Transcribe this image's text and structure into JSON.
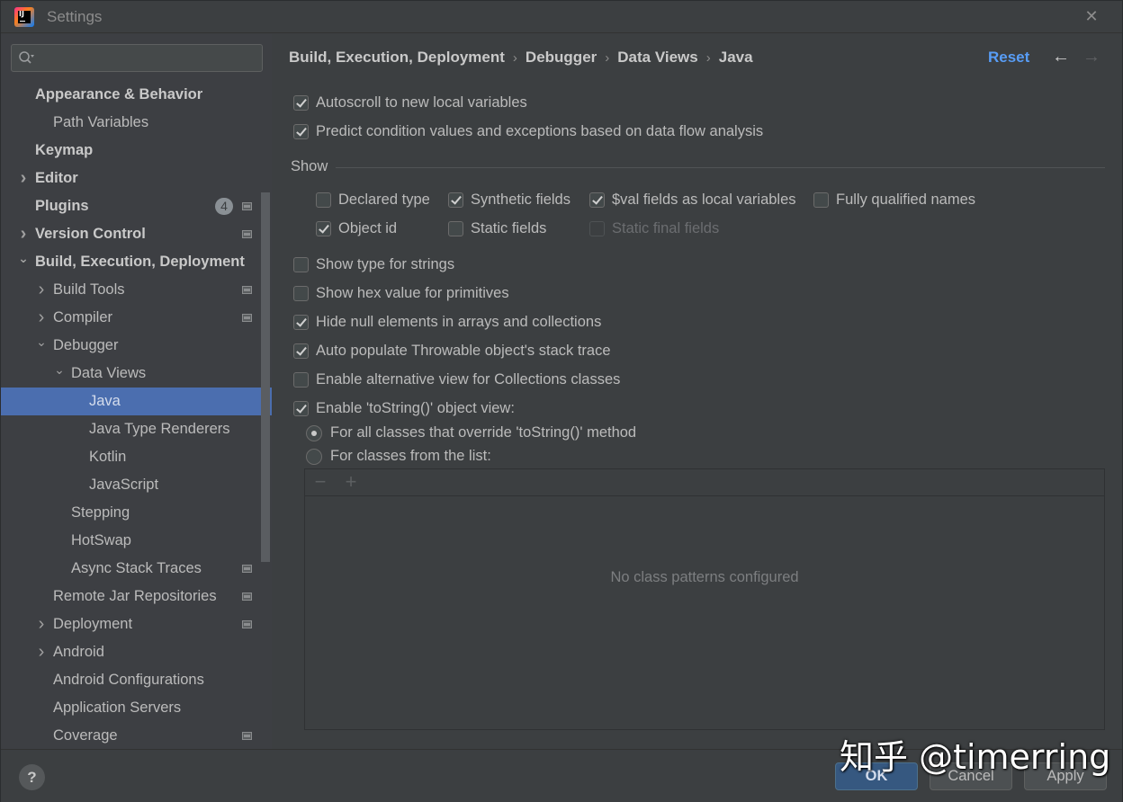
{
  "window": {
    "title": "Settings",
    "app_icon": "intellij-idea-icon",
    "close_icon": "close-icon",
    "close_glyph": "✕"
  },
  "sidebar": {
    "search": {
      "placeholder": "",
      "value": "",
      "icon": "search-icon"
    },
    "items": [
      {
        "label": "Appearance & Behavior",
        "level": 0,
        "bold": true,
        "chevron": "none"
      },
      {
        "label": "Path Variables",
        "level": 1,
        "bold": false,
        "chevron": "none"
      },
      {
        "label": "Keymap",
        "level": 0,
        "bold": true,
        "chevron": "none"
      },
      {
        "label": "Editor",
        "level": 0,
        "bold": true,
        "chevron": "collapsed"
      },
      {
        "label": "Plugins",
        "level": 0,
        "bold": true,
        "chevron": "none",
        "badge": "4",
        "project_icon": true
      },
      {
        "label": "Version Control",
        "level": 0,
        "bold": true,
        "chevron": "collapsed",
        "project_icon": true
      },
      {
        "label": "Build, Execution, Deployment",
        "level": 0,
        "bold": true,
        "chevron": "expanded"
      },
      {
        "label": "Build Tools",
        "level": 1,
        "bold": false,
        "chevron": "collapsed",
        "project_icon": true
      },
      {
        "label": "Compiler",
        "level": 1,
        "bold": false,
        "chevron": "collapsed",
        "project_icon": true
      },
      {
        "label": "Debugger",
        "level": 1,
        "bold": false,
        "chevron": "expanded"
      },
      {
        "label": "Data Views",
        "level": 2,
        "bold": false,
        "chevron": "expanded"
      },
      {
        "label": "Java",
        "level": 3,
        "bold": false,
        "chevron": "none",
        "selected": true
      },
      {
        "label": "Java Type Renderers",
        "level": 3,
        "bold": false,
        "chevron": "none"
      },
      {
        "label": "Kotlin",
        "level": 3,
        "bold": false,
        "chevron": "none"
      },
      {
        "label": "JavaScript",
        "level": 3,
        "bold": false,
        "chevron": "none"
      },
      {
        "label": "Stepping",
        "level": 2,
        "bold": false,
        "chevron": "none"
      },
      {
        "label": "HotSwap",
        "level": 2,
        "bold": false,
        "chevron": "none"
      },
      {
        "label": "Async Stack Traces",
        "level": 2,
        "bold": false,
        "chevron": "none",
        "project_icon": true
      },
      {
        "label": "Remote Jar Repositories",
        "level": 1,
        "bold": false,
        "chevron": "none",
        "project_icon": true
      },
      {
        "label": "Deployment",
        "level": 1,
        "bold": false,
        "chevron": "collapsed",
        "project_icon": true
      },
      {
        "label": "Android",
        "level": 1,
        "bold": false,
        "chevron": "collapsed"
      },
      {
        "label": "Android Configurations",
        "level": 1,
        "bold": false,
        "chevron": "none"
      },
      {
        "label": "Application Servers",
        "level": 1,
        "bold": false,
        "chevron": "none"
      },
      {
        "label": "Coverage",
        "level": 1,
        "bold": false,
        "chevron": "none",
        "project_icon": true
      }
    ]
  },
  "header": {
    "breadcrumb": [
      "Build, Execution, Deployment",
      "Debugger",
      "Data Views",
      "Java"
    ],
    "breadcrumb_separator": "›",
    "reset_label": "Reset",
    "back_glyph": "←",
    "forward_glyph": "→"
  },
  "options": {
    "autoscroll": {
      "label": "Autoscroll to new local variables",
      "checked": true
    },
    "predict": {
      "label": "Predict condition values and exceptions based on data flow analysis",
      "checked": true
    },
    "show_section_label": "Show",
    "show": {
      "declared_type": {
        "label": "Declared type",
        "checked": false
      },
      "synthetic_fields": {
        "label": "Synthetic fields",
        "checked": true
      },
      "val_fields": {
        "label": "$val fields as local variables",
        "checked": true
      },
      "fully_qualified": {
        "label": "Fully qualified names",
        "checked": false
      },
      "object_id": {
        "label": "Object id",
        "checked": true
      },
      "static_fields": {
        "label": "Static fields",
        "checked": false
      },
      "static_final_fields": {
        "label": "Static final fields",
        "checked": false,
        "disabled": true
      }
    },
    "show_type_strings": {
      "label": "Show type for strings",
      "checked": false
    },
    "show_hex": {
      "label": "Show hex value for primitives",
      "checked": false
    },
    "hide_null": {
      "label": "Hide null elements in arrays and collections",
      "checked": true
    },
    "auto_populate": {
      "label": "Auto populate Throwable object's stack trace",
      "checked": true
    },
    "alt_view": {
      "label": "Enable alternative view for Collections classes",
      "checked": false
    },
    "tostring_view": {
      "label": "Enable 'toString()' object view:",
      "checked": true
    },
    "tostring_mode": {
      "all_classes": {
        "label": "For all classes that override 'toString()' method",
        "selected": true
      },
      "from_list": {
        "label": "For classes from the list:",
        "selected": false
      }
    },
    "class_list": {
      "remove_glyph": "−",
      "add_glyph": "+",
      "empty_text": "No class patterns configured"
    }
  },
  "footer": {
    "help_label": "?",
    "ok_label": "OK",
    "cancel_label": "Cancel",
    "apply_label": "Apply"
  },
  "watermark": "知乎 @timerring"
}
